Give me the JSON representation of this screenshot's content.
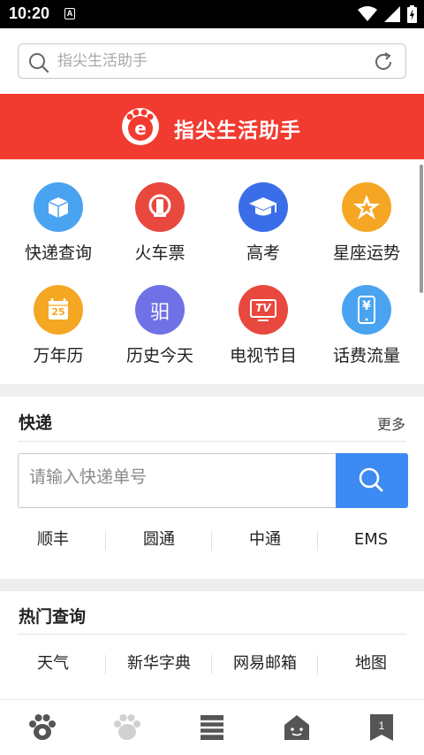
{
  "status_bar": {
    "time": "10:20",
    "notification_letter": "A"
  },
  "search": {
    "placeholder": "指尖生活助手",
    "value": ""
  },
  "banner": {
    "title": "指尖生活助手"
  },
  "services": [
    {
      "label": "快递查询",
      "icon": "package-icon",
      "color": "#4aa3f0"
    },
    {
      "label": "火车票",
      "icon": "railway-icon",
      "color": "#e8483d"
    },
    {
      "label": "高考",
      "icon": "graduation-cap-icon",
      "color": "#3a6ee8"
    },
    {
      "label": "星座运势",
      "icon": "star-icon",
      "color": "#f5a623"
    },
    {
      "label": "万年历",
      "icon": "calendar-icon",
      "color": "#f5a623",
      "day": "25"
    },
    {
      "label": "历史今天",
      "icon": "history-icon",
      "color": "#6f72e6",
      "glyph": "驲"
    },
    {
      "label": "电视节目",
      "icon": "tv-icon",
      "color": "#e8483d",
      "glyph": "TV"
    },
    {
      "label": "话费流量",
      "icon": "phone-bill-icon",
      "color": "#4aa3f0",
      "glyph": "¥"
    }
  ],
  "express": {
    "title": "快递",
    "more": "更多",
    "placeholder": "请输入快递单号",
    "carriers": [
      "顺丰",
      "圆通",
      "中通",
      "EMS"
    ]
  },
  "hot": {
    "title": "热门查询",
    "items": [
      "天气",
      "新华字典",
      "网易邮箱",
      "地图"
    ]
  },
  "bottom_nav": {
    "items": [
      {
        "icon": "paw-icon",
        "active": true
      },
      {
        "icon": "paw-outline-icon",
        "active": false
      },
      {
        "icon": "list-icon",
        "active": false
      },
      {
        "icon": "home-icon",
        "active": false
      },
      {
        "icon": "bookmark-icon",
        "active": false,
        "badge": "1"
      }
    ]
  }
}
